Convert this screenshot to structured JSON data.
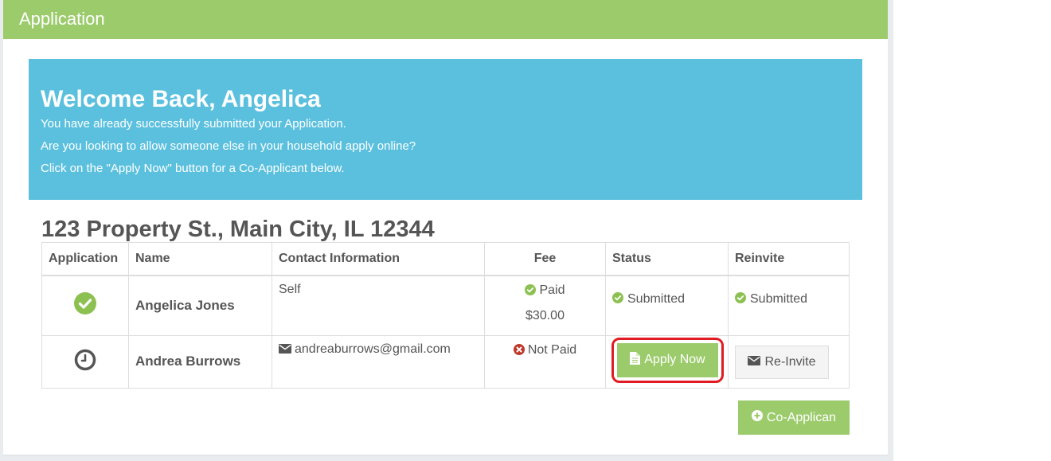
{
  "panel": {
    "title": "Application"
  },
  "welcome": {
    "heading": "Welcome Back, Angelica",
    "lines": [
      "You have already successfully submitted your Application.",
      "Are you looking to allow someone else in your household apply online?",
      "Click on the \"Apply Now\" button for a Co-Applicant below."
    ]
  },
  "property": {
    "address": "123 Property St., Main City, IL 12344"
  },
  "table": {
    "headers": [
      "Application",
      "Name",
      "Contact Information",
      "Fee",
      "Status",
      "Reinvite"
    ],
    "rows": [
      {
        "application_icon": "check-circle-icon",
        "name": "Angelica Jones",
        "contact": "Self",
        "fee_status": "Paid",
        "fee_amount": "$30.00",
        "status": "Submitted",
        "reinvite": "Submitted"
      },
      {
        "application_icon": "clock-icon",
        "name": "Andrea Burrows",
        "contact": "andreaburrows@gmail.com",
        "fee_status": "Not Paid",
        "status_button": "Apply Now",
        "reinvite_button": "Re-Invite"
      }
    ]
  },
  "actions": {
    "add_coapplicant": "Co-Applican"
  },
  "colors": {
    "header_green": "#9ccb6c",
    "welcome_blue": "#5bc0de",
    "success_green": "#8cc152",
    "danger_red": "#c0392b",
    "highlight_red": "#e11b22"
  }
}
